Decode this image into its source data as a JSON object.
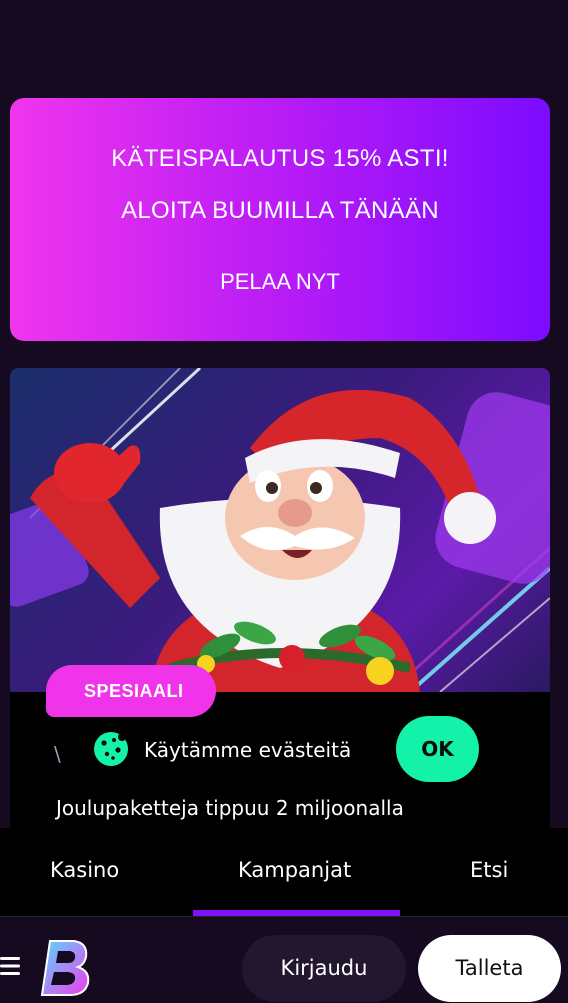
{
  "promo": {
    "line1": "KÄTEISPALAUTUS 15% ASTI!",
    "line2": "ALOITA BUUMILLA TÄNÄÄN",
    "cta": "PELAA NYT"
  },
  "promotion_card": {
    "badge": "SPESIAALI",
    "subtitle_fragment": "\\",
    "title": "Joulupaketteja tippuu 2 miljoonalla"
  },
  "cookie_notice": {
    "icon": "cookie-icon",
    "text": "Käytämme evästeitä",
    "ok_label": "OK"
  },
  "tabs": [
    {
      "label": "Kasino"
    },
    {
      "label": "Kampanjat",
      "active": true
    },
    {
      "label": "Etsi"
    }
  ],
  "bottom_bar": {
    "menu_icon": "hamburger-icon",
    "logo_icon": "brand-b-logo",
    "login_label": "Kirjaudu",
    "deposit_label": "Talleta"
  },
  "colors": {
    "background": "#150a1f",
    "promo_gradient_start": "#f035ee",
    "promo_gradient_end": "#7c0bff",
    "badge": "#f034ea",
    "ok_button": "#13f2a8",
    "tab_underline": "#7e11f5"
  }
}
